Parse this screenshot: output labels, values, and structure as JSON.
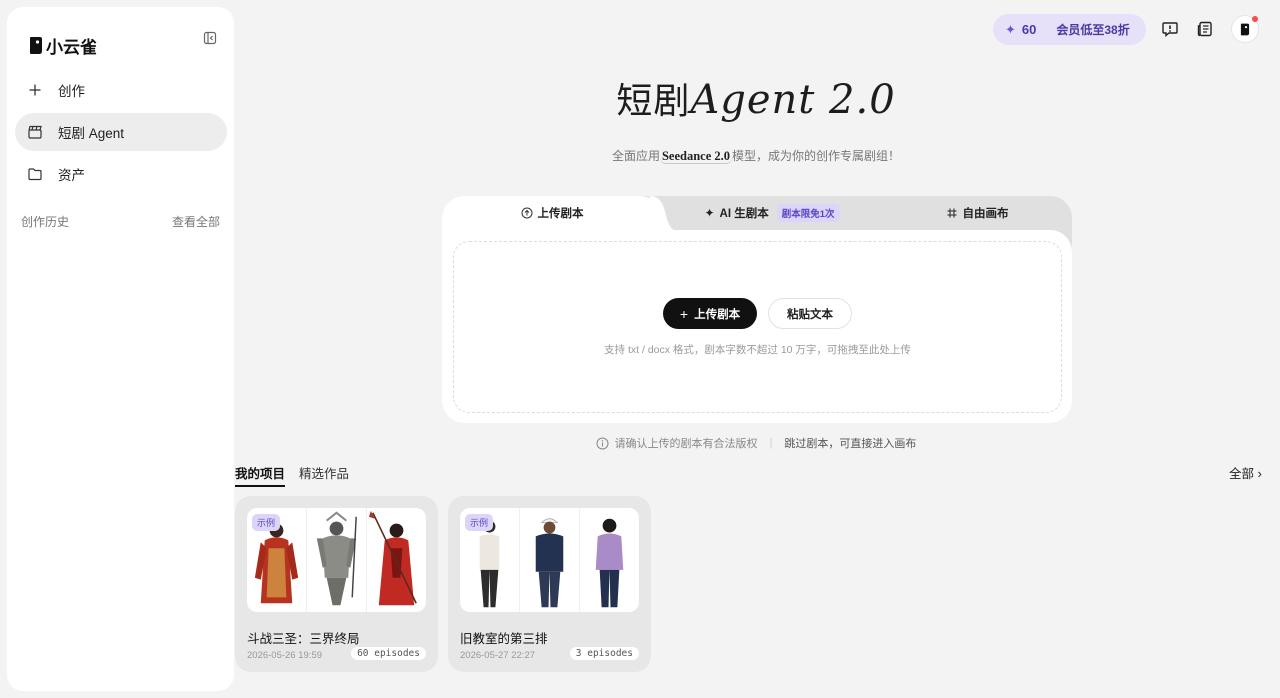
{
  "sidebar": {
    "logo_text": "小云雀",
    "nav": [
      {
        "label": "创作"
      },
      {
        "label": "短剧 Agent"
      },
      {
        "label": "资产"
      }
    ],
    "history_label": "创作历史",
    "view_all": "查看全部"
  },
  "topbar": {
    "credits": "60",
    "vip_label": "会员低至38折"
  },
  "hero": {
    "title_zh": "短剧",
    "title_en": "Agent 2.0",
    "subtitle_pre": "全面应用",
    "subtitle_brand": "Seedance 2.0",
    "subtitle_post": "模型，成为你的创作专属剧组！"
  },
  "tabs": {
    "upload": "上传剧本",
    "ai": "AI 生剧本",
    "ai_badge": "剧本限免1次",
    "canvas": "自由画布"
  },
  "dropzone": {
    "upload_btn": "上传剧本",
    "paste_btn": "粘贴文本",
    "hint": "支持 txt / docx 格式，剧本字数不超过 10 万字，可拖拽至此处上传"
  },
  "notice": {
    "copyright": "请确认上传的剧本有合法版权",
    "skip": "跳过剧本，可直接进入画布"
  },
  "projects": {
    "tab_mine": "我的项目",
    "tab_featured": "精选作品",
    "all": "全部",
    "items": [
      {
        "tag": "示例",
        "title": "斗战三圣：三界终局",
        "date": "2026-05-26 19:59",
        "episodes": "60 episodes"
      },
      {
        "tag": "示例",
        "title": "旧教室的第三排",
        "date": "2026-05-27 22:27",
        "episodes": "3 episodes"
      }
    ]
  },
  "colors": {
    "accent": "#6d54d8",
    "badge_bg": "#ddd5f7",
    "primary_btn": "#111111"
  }
}
